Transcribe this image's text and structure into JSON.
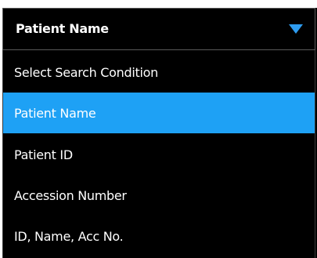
{
  "search_condition": {
    "selected_value": "Patient Name",
    "toggle_icon": "triangle-down-icon",
    "accent_color": "#1ea1f5",
    "options": [
      {
        "label": "Select Search Condition",
        "selected": false
      },
      {
        "label": "Patient Name",
        "selected": true
      },
      {
        "label": "Patient ID",
        "selected": false
      },
      {
        "label": "Accession Number",
        "selected": false
      },
      {
        "label": "ID, Name, Acc No.",
        "selected": false
      }
    ]
  }
}
